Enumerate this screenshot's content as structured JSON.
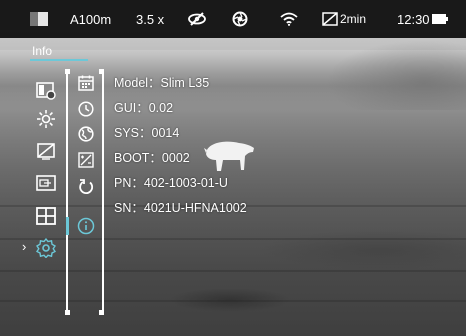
{
  "status_bar": {
    "model_mode_icon": "palette-icon",
    "objective": "A100m",
    "zoom": "3.5 x",
    "hotspot_off_icon": "eye-off-icon",
    "ir_icon": "aperture-icon",
    "wifi_icon": "wifi-icon",
    "auto_off_icon": "screen-off-icon",
    "auto_off_time": "2min",
    "time": "12:30",
    "battery_icon": "battery-icon"
  },
  "menu": {
    "title": "Info",
    "accent_color": "#6cc8d8",
    "items": [
      {
        "name": "image-settings-icon"
      },
      {
        "name": "brightness-icon"
      },
      {
        "name": "screen-off-settings-icon"
      },
      {
        "name": "pip-icon"
      },
      {
        "name": "layout-icon"
      },
      {
        "name": "settings-icon"
      }
    ],
    "sub_items": [
      {
        "name": "calendar-icon"
      },
      {
        "name": "clock-icon"
      },
      {
        "name": "globe-icon"
      },
      {
        "name": "calibration-icon"
      },
      {
        "name": "reset-icon"
      },
      {
        "name": "info-icon"
      }
    ]
  },
  "info": {
    "model": "Model：Slim L35",
    "gui": "GUI：0.02",
    "sys": "SYS：0014",
    "boot": "BOOT：0002",
    "pn": "PN：402-1003-01-U",
    "sn": "SN：4021U-HFNA1002"
  }
}
